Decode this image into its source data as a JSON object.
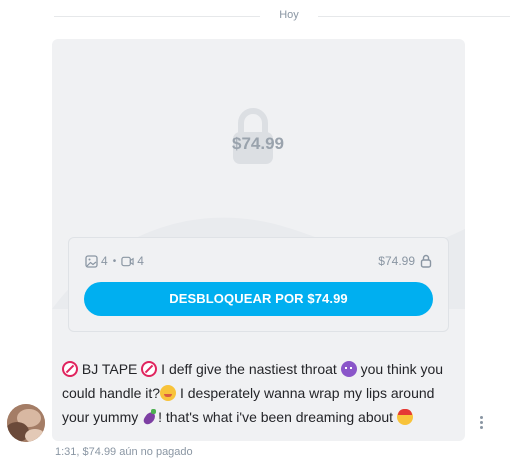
{
  "date_separator": "Hoy",
  "locked_post": {
    "price_overlay": "$74.99",
    "media_counts": {
      "images": "4",
      "separator": "•",
      "videos": "4"
    },
    "price_label": "$74.99",
    "unlock_button_label": "DESBLOQUEAR POR $74.99"
  },
  "message": {
    "segments": [
      " BJ TAPE ",
      " I deff give the nastiest throat ",
      " you think you could handle it?",
      " I desperately wanna wrap my lips around your yummy ",
      "! that's what i've been dreaming about "
    ]
  },
  "meta": {
    "time": "1:31,",
    "price": "$74.99",
    "status": "aún no pagado"
  },
  "icons": {
    "lock": "lock-icon",
    "image": "image-icon",
    "video": "video-icon",
    "more": "more-vertical-icon",
    "emoji_no18": "no-under-18-emoji",
    "emoji_devil": "smiling-devil-emoji",
    "emoji_face": "drooling-face-emoji",
    "emoji_eggplant": "eggplant-emoji",
    "emoji_hot": "hot-face-emoji"
  },
  "colors": {
    "accent": "#00aff0",
    "muted": "#8a96a3",
    "card_bg": "#f0f1f3"
  }
}
